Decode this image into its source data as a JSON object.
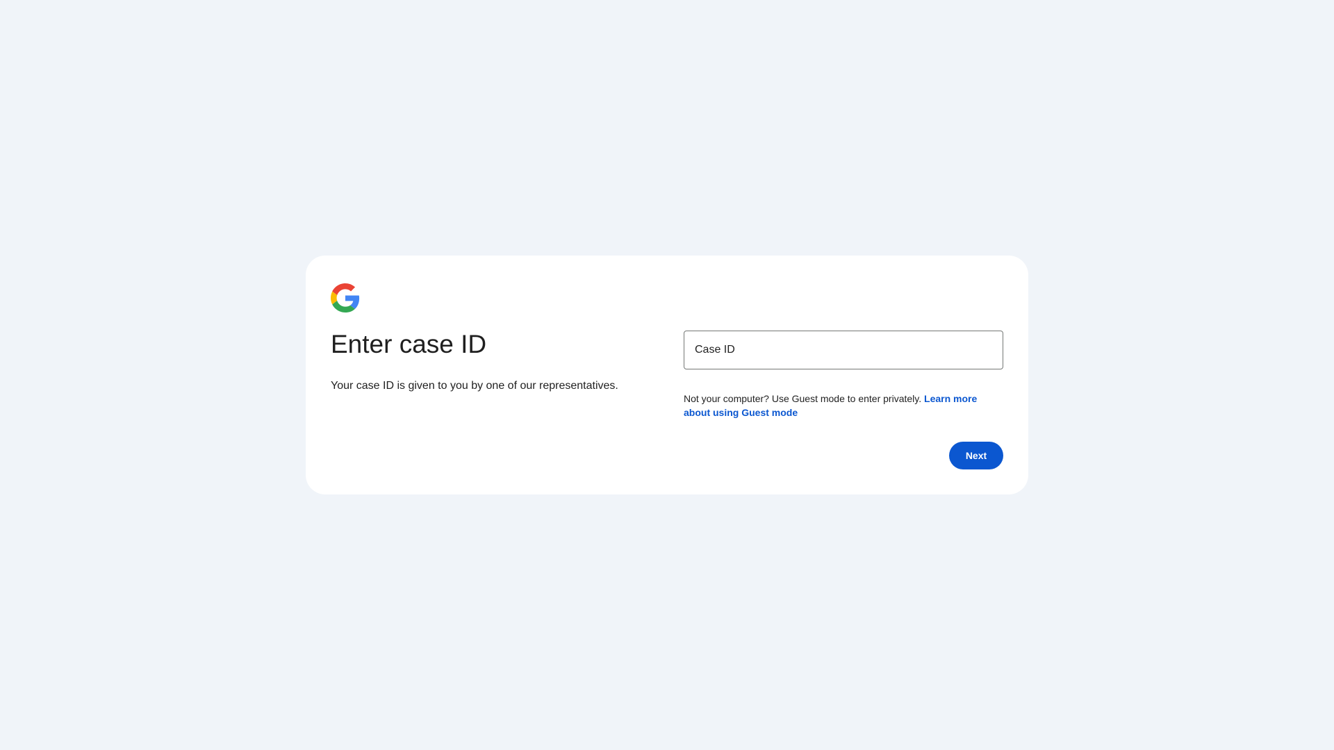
{
  "brand": {
    "logo_icon": "google-g-logo-icon",
    "colors": {
      "blue": "#4285F4",
      "red": "#EA4335",
      "yellow": "#FBBC05",
      "green": "#34A853"
    }
  },
  "page": {
    "title": "Enter case ID",
    "subtitle": "Your case ID is given to you by one of our representatives."
  },
  "form": {
    "case_id": {
      "value": "",
      "placeholder": "Case ID"
    },
    "guest_note_text": "Not your computer? Use Guest mode to enter privately. ",
    "guest_link_text": "Learn more about using Guest mode",
    "next_label": "Next"
  },
  "theme": {
    "accent": "#0b57d0",
    "background": "#f0f4f9",
    "card": "#ffffff",
    "text": "#1f1f1f",
    "field_border": "#747775"
  }
}
